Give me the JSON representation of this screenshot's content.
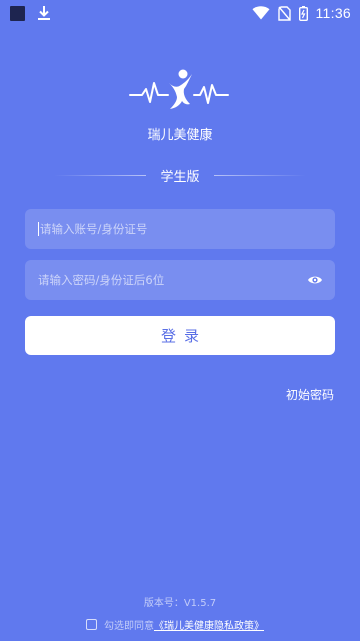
{
  "status_bar": {
    "time": "11:36",
    "icons": [
      "app-square-icon",
      "download-icon",
      "wifi-icon",
      "no-sim-icon",
      "battery-icon"
    ]
  },
  "brand": {
    "name": "瑞儿美健康",
    "logo_icon": "person-heartbeat-logo"
  },
  "edition": {
    "label": "学生版"
  },
  "form": {
    "account_placeholder": "请输入账号/身份证号",
    "password_placeholder": "请输入密码/身份证后6位",
    "login_label": "登录",
    "show_password_icon": "eye-icon"
  },
  "links": {
    "initial_password": "初始密码"
  },
  "footer": {
    "version": "版本号：V1.5.7",
    "agree_prefix": "勾选即同意",
    "policy_link": "《瑞儿美健康隐私政策》"
  },
  "colors": {
    "background": "#6079EE",
    "button_text": "#5A6FE6",
    "button_bg": "#ffffff"
  }
}
